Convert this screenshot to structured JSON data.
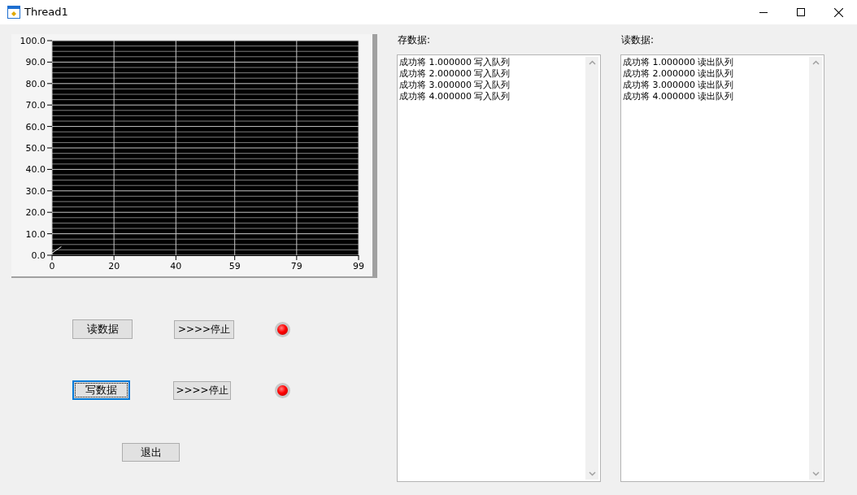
{
  "window": {
    "title": "Thread1"
  },
  "chart": {
    "chart_data": {
      "type": "line",
      "grid": true,
      "x": [
        0,
        1,
        2,
        3
      ],
      "series": [
        {
          "color": "#ffffff",
          "values": [
            1,
            2,
            3,
            4
          ]
        }
      ],
      "xlim": [
        0,
        99
      ],
      "ylim": [
        0,
        100
      ],
      "xticks": [
        0,
        20,
        40,
        59,
        79,
        99
      ],
      "yticks": [
        {
          "value": 0,
          "label": "0.0"
        },
        {
          "value": 10,
          "label": "10.0"
        },
        {
          "value": 20,
          "label": "20.0"
        },
        {
          "value": 30,
          "label": "30.0"
        },
        {
          "value": 40,
          "label": "40.0"
        },
        {
          "value": 50,
          "label": "50.0"
        },
        {
          "value": 60,
          "label": "60.0"
        },
        {
          "value": 70,
          "label": "70.0"
        },
        {
          "value": 80,
          "label": "80.0"
        },
        {
          "value": 90,
          "label": "90.0"
        },
        {
          "value": 100,
          "label": "100.0"
        }
      ]
    }
  },
  "controls": {
    "rows": [
      {
        "start_button": "读数据",
        "stop_button": ">>>>停止",
        "focused": false,
        "led_on": true
      },
      {
        "start_button": "写数据",
        "stop_button": ">>>>停止",
        "focused": true,
        "led_on": true
      }
    ],
    "exit_button": "退出"
  },
  "panels": [
    {
      "label": "存数据:",
      "lines": [
        "成功将 1.000000 写入队列",
        "成功将 2.000000 写入队列",
        "成功将 3.000000 写入队列",
        "成功将 4.000000 写入队列"
      ]
    },
    {
      "label": "读数据:",
      "lines": [
        "成功将 1.000000 读出队列",
        "成功将 2.000000 读出队列",
        "成功将 3.000000 读出队列",
        "成功将 4.000000 读出队列"
      ]
    }
  ]
}
